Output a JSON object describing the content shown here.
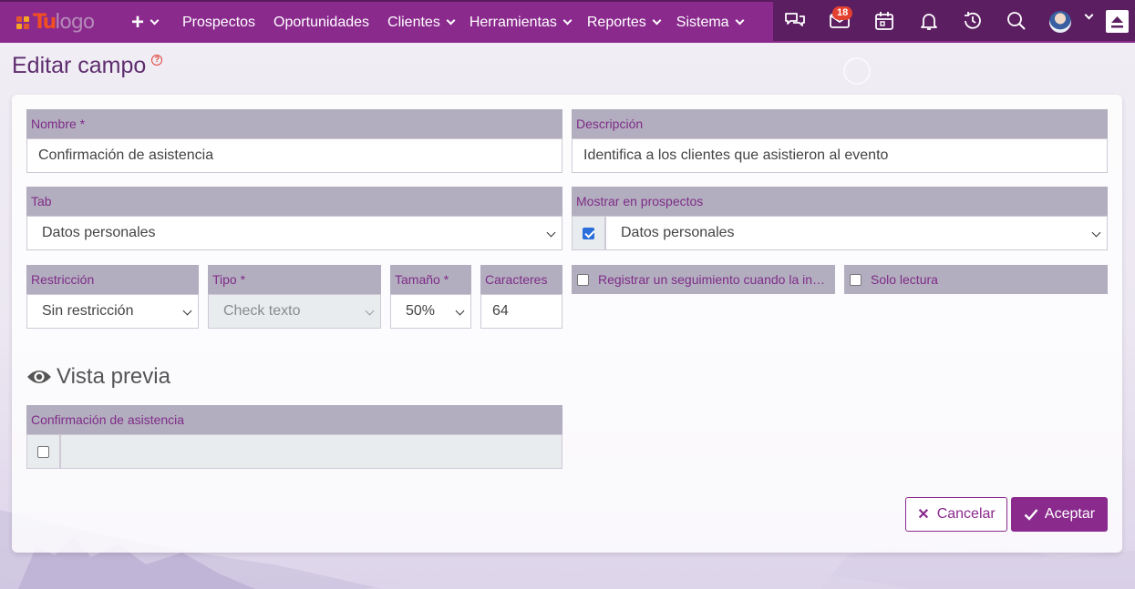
{
  "navbar": {
    "logo_tu": "Tu",
    "logo_text": "logo",
    "plus": "+",
    "items": [
      {
        "label": "Prospectos",
        "dropdown": false
      },
      {
        "label": "Oportunidades",
        "dropdown": false
      },
      {
        "label": "Clientes",
        "dropdown": true
      },
      {
        "label": "Herramientas",
        "dropdown": true
      },
      {
        "label": "Reportes",
        "dropdown": true
      },
      {
        "label": "Sistema",
        "dropdown": true
      }
    ],
    "mail_badge": "18",
    "icons": [
      "chat-icon",
      "mail-icon",
      "calendar-icon",
      "bell-icon",
      "history-icon",
      "search-icon",
      "avatar",
      "scroll-top-icon"
    ],
    "accent_color": "#8a2a8d",
    "right_bg_color": "#5b1e61"
  },
  "page": {
    "title": "Editar campo",
    "help": "?"
  },
  "form": {
    "nombre": {
      "label": "Nombre *",
      "value": "Confirmación de asistencia"
    },
    "descripcion": {
      "label": "Descripción",
      "value": "Identifica a los clientes que asistieron al evento"
    },
    "tab": {
      "label": "Tab",
      "value": "Datos personales"
    },
    "mostrar": {
      "label": "Mostrar en prospectos",
      "value": "Datos personales",
      "checked": true
    },
    "restriccion": {
      "label": "Restricción",
      "value": "Sin restricción"
    },
    "tipo": {
      "label": "Tipo *",
      "value": "Check texto"
    },
    "tamano": {
      "label": "Tamaño *",
      "value": "50%"
    },
    "caracteres": {
      "label": "Caracteres",
      "value": "64"
    },
    "registrar": {
      "label": "Registrar un seguimiento cuando la in…",
      "checked": false
    },
    "solo_lectura": {
      "label": "Solo lectura",
      "checked": false
    }
  },
  "preview": {
    "title": "Vista previa",
    "field_label": "Confirmación de asistencia"
  },
  "actions": {
    "cancel": "Cancelar",
    "accept": "Aceptar"
  }
}
